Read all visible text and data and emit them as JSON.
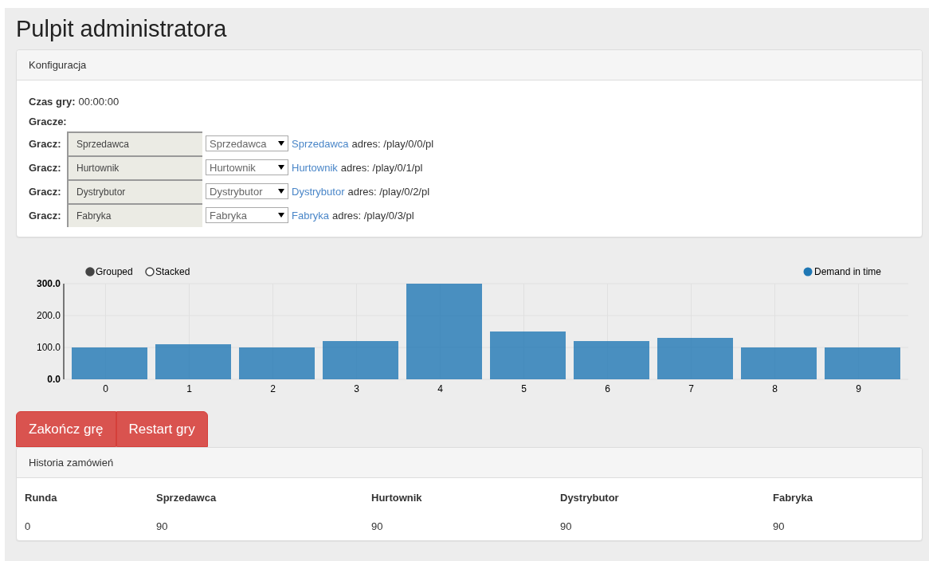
{
  "title": "Pulpit administratora",
  "config": {
    "heading": "Konfiguracja",
    "time_label": "Czas gry:",
    "time_value": "00:00:00",
    "players_label": "Gracze:",
    "players": [
      {
        "label": "Gracz:",
        "name": "Sprzedawca",
        "role": "Sprzedawca",
        "link": "Sprzedawca",
        "address": "adres: /play/0/0/pl"
      },
      {
        "label": "Gracz:",
        "name": "Hurtownik",
        "role": "Hurtownik",
        "link": "Hurtownik",
        "address": "adres: /play/0/1/pl"
      },
      {
        "label": "Gracz:",
        "name": "Dystrybutor",
        "role": "Dystrybutor",
        "link": "Dystrybutor",
        "address": "adres: /play/0/2/pl"
      },
      {
        "label": "Gracz:",
        "name": "Fabryka",
        "role": "Fabryka",
        "link": "Fabryka",
        "address": "adres: /play/0/3/pl"
      }
    ]
  },
  "chart_modes": [
    {
      "label": "Grouped",
      "selected": true
    },
    {
      "label": "Stacked",
      "selected": false
    }
  ],
  "chart_data": {
    "type": "bar",
    "categories": [
      "0",
      "1",
      "2",
      "3",
      "4",
      "5",
      "6",
      "7",
      "8",
      "9"
    ],
    "series": [
      {
        "name": "Demand in time",
        "color": "#1f77b4",
        "values": [
          100,
          110,
          100,
          120,
          300,
          150,
          120,
          130,
          100,
          100
        ]
      }
    ],
    "grid": true,
    "ylim": [
      0,
      300
    ],
    "yticks": [
      {
        "value": 0,
        "label": "0.0"
      },
      {
        "value": 100,
        "label": "100.0"
      },
      {
        "value": 200,
        "label": "200.0"
      },
      {
        "value": 300,
        "label": "300.0"
      }
    ]
  },
  "buttons": [
    "Zakończ grę",
    "Restart gry"
  ],
  "history": {
    "heading": "Historia zamówień",
    "columns": [
      "Runda",
      "Sprzedawca",
      "Hurtownik",
      "Dystrybutor",
      "Fabryka"
    ],
    "rows": [
      [
        "0",
        "90",
        "90",
        "90",
        "90"
      ]
    ]
  }
}
